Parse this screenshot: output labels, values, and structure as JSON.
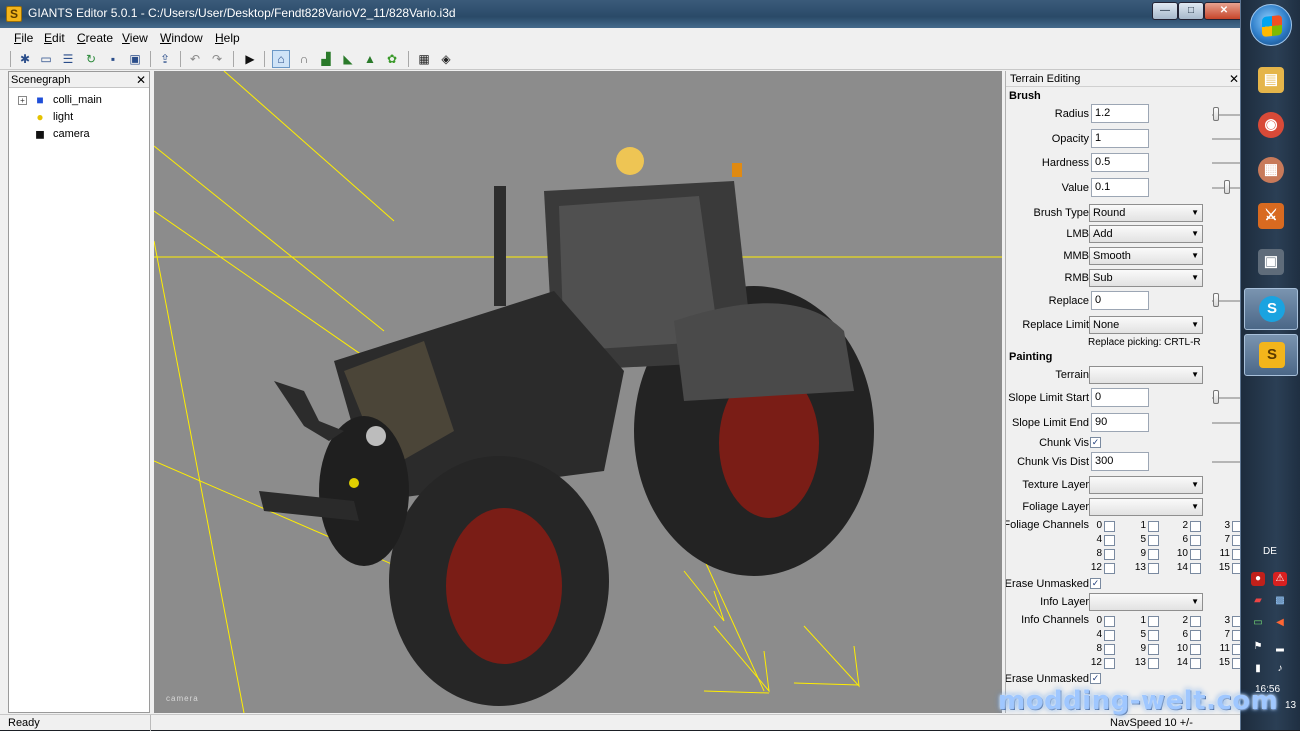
{
  "window": {
    "title": "GIANTS Editor 5.0.1 - C:/Users/User/Desktop/Fendt828VarioV2_11/828Vario.i3d",
    "app_glyph": "S",
    "controls": {
      "minimize": "—",
      "maximize": "□",
      "close": "✕"
    }
  },
  "menu": [
    {
      "label": "File",
      "u": "F",
      "rest": "ile"
    },
    {
      "label": "Edit",
      "u": "E",
      "rest": "dit"
    },
    {
      "label": "Create",
      "u": "C",
      "rest": "reate"
    },
    {
      "label": "View",
      "u": "V",
      "rest": "iew"
    },
    {
      "label": "Window",
      "u": "W",
      "rest": "indow"
    },
    {
      "label": "Help",
      "u": "H",
      "rest": "elp"
    }
  ],
  "toolbar": {
    "icons": [
      "new-icon",
      "open-icon",
      "list-icon",
      "refresh-icon",
      "save-icon",
      "save-all-icon",
      "import-icon",
      "undo-icon",
      "redo-icon",
      "play-icon",
      "home-icon",
      "magnet-icon",
      "terrain-sculpt-icon",
      "terrain-paint-icon",
      "terrain-foliage-icon",
      "grass-icon",
      "render-icon",
      "render-settings-icon"
    ]
  },
  "scenegraph": {
    "title": "Scenegraph",
    "close": "✕",
    "nodes": [
      {
        "label": "colli_main",
        "icon": "cube-icon",
        "expander": "+"
      },
      {
        "label": "light",
        "icon": "lightbulb-icon"
      },
      {
        "label": "camera",
        "icon": "camera-icon"
      }
    ]
  },
  "viewport": {
    "camera_label": "camera",
    "accent_line": "#ffee00",
    "tractor_body": "#2b2b2b",
    "wheel_rim": "#7a1d16"
  },
  "terrain": {
    "title": "Terrain Editing",
    "close": "✕",
    "brush_section": "Brush",
    "radius_label": "Radius",
    "radius_value": "1.2",
    "opacity_label": "Opacity",
    "opacity_value": "1",
    "hardness_label": "Hardness",
    "hardness_value": "0.5",
    "value_label": "Value",
    "value_value": "0.1",
    "brush_type_label": "Brush Type",
    "brush_type_value": "Round",
    "lmb_label": "LMB",
    "lmb_value": "Add",
    "mmb_label": "MMB",
    "mmb_value": "Smooth",
    "rmb_label": "RMB",
    "rmb_value": "Sub",
    "replace_label": "Replace",
    "replace_value": "0",
    "replace_limit_label": "Replace Limit",
    "replace_limit_value": "None",
    "replace_picking": "Replace picking: CRTL-R",
    "painting_section": "Painting",
    "terrain_label": "Terrain",
    "terrain_value": "",
    "slope_start_label": "Slope Limit Start",
    "slope_start_value": "0",
    "slope_end_label": "Slope Limit End",
    "slope_end_value": "90",
    "chunk_vis_label": "Chunk Vis",
    "chunk_vis_checked": true,
    "chunk_vis_dist_label": "Chunk Vis Dist",
    "chunk_vis_dist_value": "300",
    "texture_layer_label": "Texture Layer",
    "texture_layer_value": "",
    "foliage_layer_label": "Foliage Layer",
    "foliage_layer_value": "",
    "foliage_channels_label": "Foliage Channels",
    "erase_unmasked_label": "Erase Unmasked",
    "info_layer_label": "Info Layer",
    "info_layer_value": "",
    "info_channels_label": "Info Channels",
    "erase_unmasked2_label": "Erase Unmasked",
    "channel_numbers": [
      "0",
      "1",
      "2",
      "3",
      "4",
      "5",
      "6",
      "7",
      "8",
      "9",
      "10",
      "11",
      "12",
      "13",
      "14",
      "15"
    ],
    "select_arrow": "▼",
    "check_mark": "✓"
  },
  "status": {
    "left": "Ready",
    "right": "NavSpeed 10 +/-"
  },
  "taskbar": {
    "language": "DE",
    "clock": "16:56",
    "date_fragment": "13",
    "apps": [
      {
        "name": "explorer",
        "glyph": "▤",
        "color": "#e5b54a"
      },
      {
        "name": "chrome",
        "glyph": "◉",
        "color": "#d84a38"
      },
      {
        "name": "calendar",
        "glyph": "▦",
        "color": "#c87a5a"
      },
      {
        "name": "sword-app",
        "glyph": "⚔",
        "color": "#d86a20"
      },
      {
        "name": "truck-app",
        "glyph": "▣",
        "color": "#5f6c7a"
      },
      {
        "name": "skype",
        "glyph": "S",
        "color": "#1aa3e0"
      },
      {
        "name": "giants-editor",
        "glyph": "S",
        "color": "#f3b51b"
      }
    ]
  },
  "watermark": "modding-welt.com"
}
